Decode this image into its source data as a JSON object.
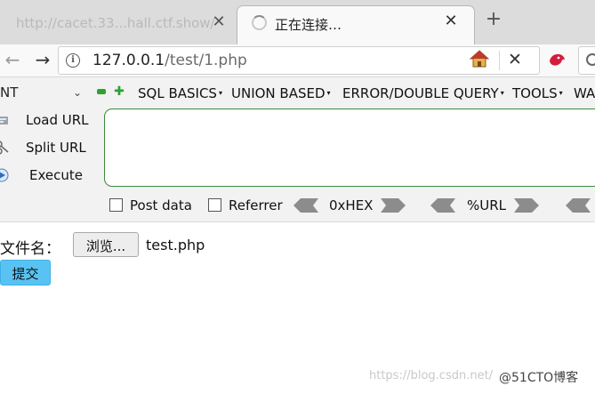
{
  "tabs": [
    {
      "title": "http://cacet.33...hall.ctf.show/",
      "state": "background"
    },
    {
      "title": "正在连接…",
      "state": "active-loading"
    }
  ],
  "icons": {
    "tab_close": "close-icon",
    "new_tab": "plus-icon",
    "back": "back-arrow-icon",
    "forward": "forward-arrow-icon",
    "info": "info-icon",
    "home": "home-icon",
    "stop": "close-icon",
    "extension": "hackbar-extension-icon",
    "search": "search-icon"
  },
  "tab_close_glyph": "✕",
  "new_tab_glyph": "+",
  "nav": {
    "back_glyph": "←",
    "forward_glyph": "→",
    "info_glyph": "i",
    "stop_glyph": "✕",
    "url_host": "127.0.0.1",
    "url_path": "/test/1.php"
  },
  "hackbar": {
    "select_value": "NT",
    "select_caret": "⌄",
    "plus_glyph": "✚",
    "menu": [
      {
        "label": "SQL BASICS",
        "has_dropdown": true
      },
      {
        "label": "UNION BASED",
        "has_dropdown": true
      },
      {
        "label": "ERROR/DOUBLE QUERY",
        "has_dropdown": true
      },
      {
        "label": "TOOLS",
        "has_dropdown": true
      },
      {
        "label": "WA",
        "has_dropdown": false
      }
    ],
    "dropdown_glyph": "▾",
    "actions": [
      "Load URL",
      "Split URL",
      "Execute"
    ],
    "checkboxes": [
      {
        "label": "Post data",
        "checked": false
      },
      {
        "label": "Referrer",
        "checked": false
      }
    ],
    "encoders": [
      "0xHEX",
      "%URL"
    ]
  },
  "page": {
    "file_label": "文件名：",
    "browse_button": "浏览...",
    "selected_file": "test.php",
    "submit_button": "提交"
  },
  "watermark": {
    "url": "https://blog.csdn.net/",
    "brand": "@51CTO博客"
  },
  "colors": {
    "tabstrip": "#dcdcdc",
    "toolbar": "#f9f9f9",
    "hackbar_bg": "#f2f2f2",
    "textarea_border": "#3c8a3c",
    "hackbar_green": "#2ea12e",
    "submit_button": "#58c3f3"
  }
}
